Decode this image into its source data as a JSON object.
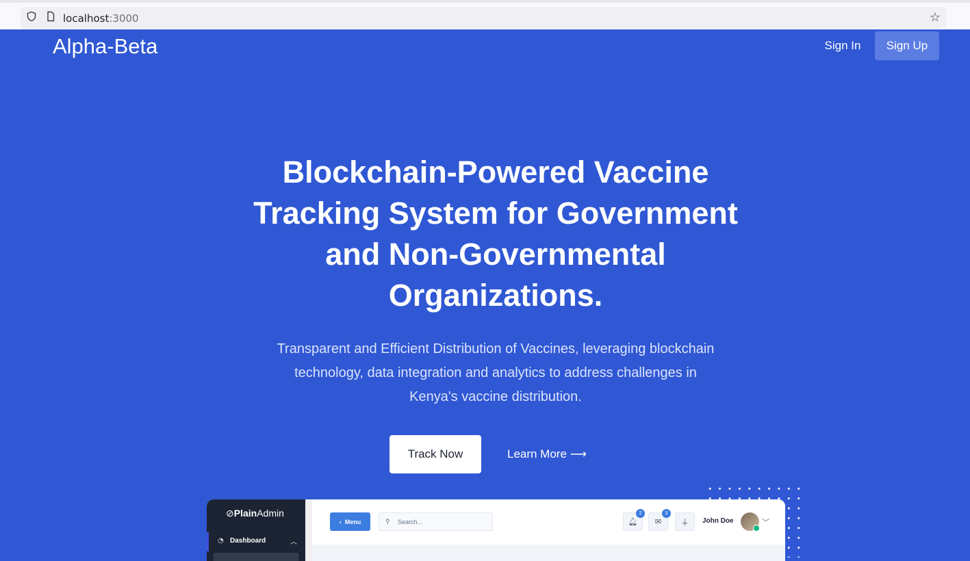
{
  "browser": {
    "url_host": "localhost",
    "url_port": ":3000"
  },
  "navbar": {
    "brand": "Alpha-Beta",
    "sign_in": "Sign In",
    "sign_up": "Sign Up"
  },
  "hero": {
    "title": "Blockchain-Powered Vaccine Tracking System for Government and Non-Governmental Organizations.",
    "subtitle": "Transparent and Efficient Distribution of Vaccines, leveraging blockchain technology, data integration and analytics to address challenges in Kenya's vaccine distribution.",
    "primary_cta": "Track Now",
    "secondary_cta": "Learn More ⟶"
  },
  "preview": {
    "logo_bold": "Plain",
    "logo_rest": "Admin",
    "sidebar_item": "Dashboard",
    "menu_button": "Menu",
    "search_placeholder": "Search...",
    "notifications_count": "2",
    "messages_count": "3",
    "user_name": "John Doe"
  },
  "colors": {
    "hero_bg": "#3058d4",
    "signup_bg": "#5b7de3",
    "preview_sidebar": "#1c2434",
    "preview_accent": "#3c7de0"
  }
}
